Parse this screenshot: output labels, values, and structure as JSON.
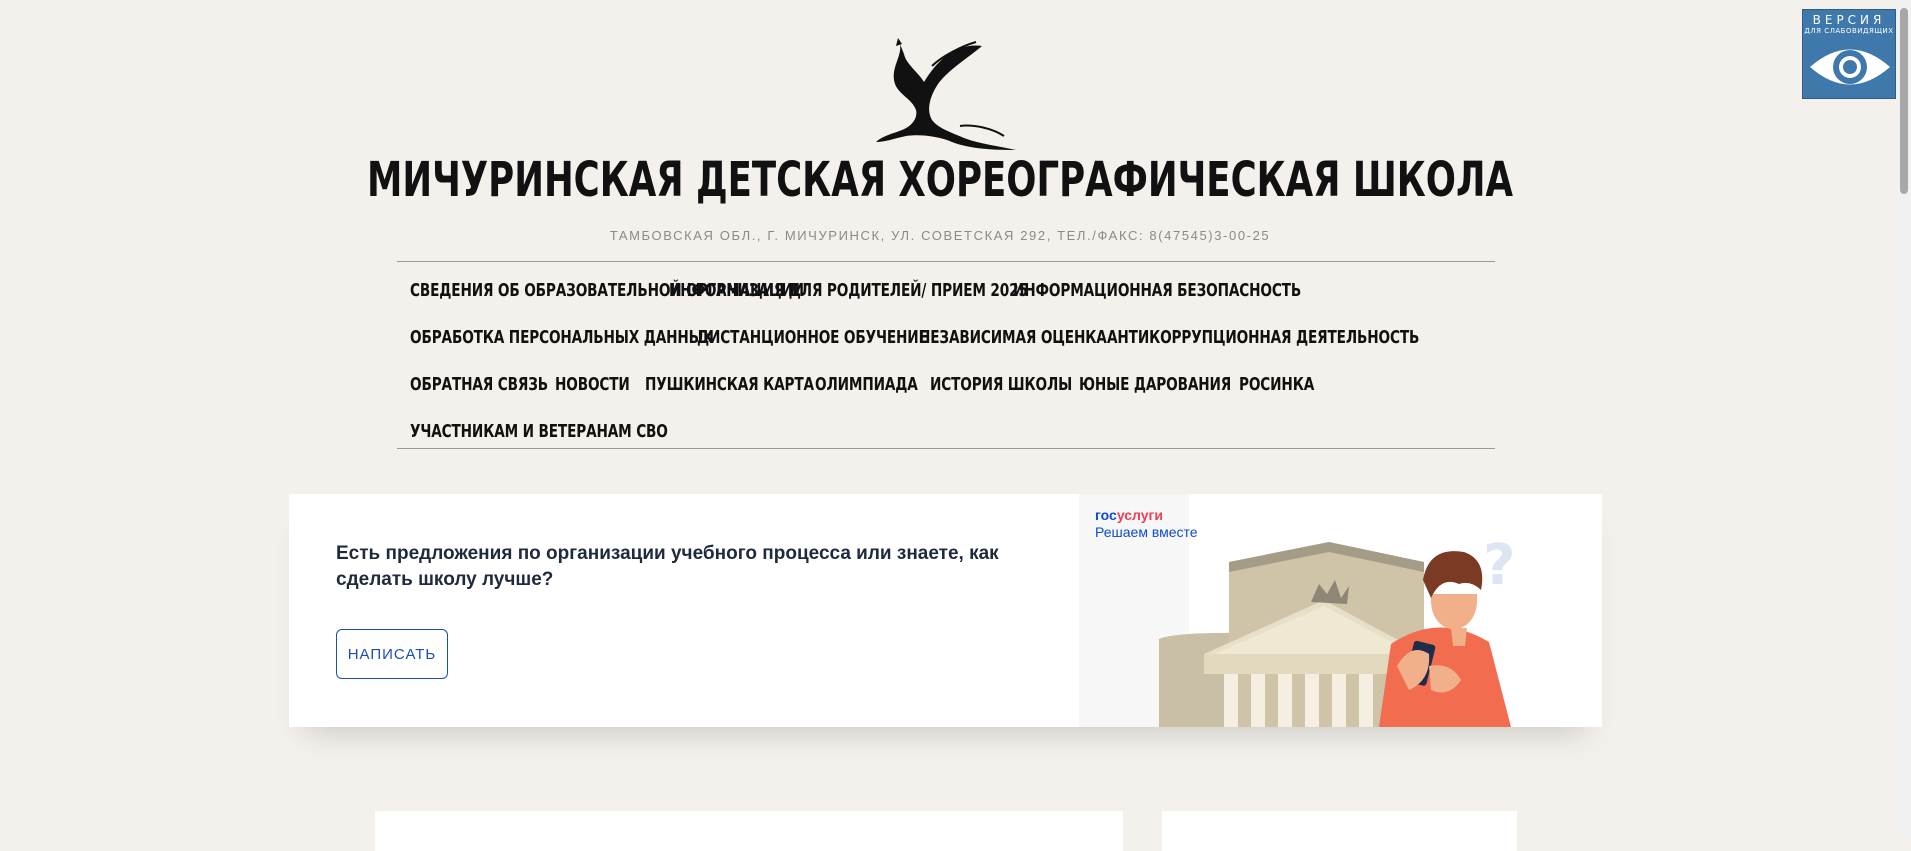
{
  "site": {
    "title": "МИЧУРИНСКАЯ ДЕТСКАЯ ХОРЕОГРАФИЧЕСКАЯ ШКОЛА",
    "subtitle": "ТАМБОВСКАЯ ОБЛ., Г. МИЧУРИНСК, УЛ. СОВЕТСКАЯ 292, ТЕЛ./ФАКС: 8(47545)3-00-25",
    "logo_icon": "ballerina-logo"
  },
  "accessibility": {
    "line1": "ВЕРСИЯ",
    "line2": "ДЛЯ СЛАБОВИДЯЩИХ",
    "icon": "eye-icon",
    "color": "#3f78ab"
  },
  "nav": {
    "rows": [
      [
        "СВЕДЕНИЯ ОБ ОБРАЗОВАТЕЛЬНОЙ ОРГАНИЗАЦИИ",
        "ИНФОРМАЦИЯ ДЛЯ РОДИТЕЛЕЙ/ ПРИЕМ 2025",
        "ИНФОРМАЦИОННАЯ БЕЗОПАСНОСТЬ"
      ],
      [
        "ОБРАБОТКА ПЕРСОНАЛЬНЫХ ДАННЫХ",
        "ДИСТАНЦИОННОЕ ОБУЧЕНИЕ",
        "НЕЗАВИСИМАЯ ОЦЕНКА",
        "АНТИКОРРУПЦИОННАЯ ДЕЯТЕЛЬНОСТЬ"
      ],
      [
        "ОБРАТНАЯ СВЯЗЬ",
        "НОВОСТИ",
        "ПУШКИНСКАЯ КАРТА",
        "ОЛИМПИАДА",
        "ИСТОРИЯ ШКОЛЫ",
        "ЮНЫЕ ДАРОВАНИЯ",
        "РОСИНКА"
      ],
      [
        "УЧАСТНИКАМ И ВЕТЕРАНАМ СВО"
      ]
    ]
  },
  "gosuslugi": {
    "text": "Есть предложения по организации учебного процесса или знаете, как сделать школу лучше?",
    "button": "НАПИСАТЬ",
    "logo_part1": "гос",
    "logo_part2": "услуги",
    "tagline": "Решаем вместе",
    "brand_blue": "#0d4cd3",
    "brand_red": "#ee3f58"
  }
}
